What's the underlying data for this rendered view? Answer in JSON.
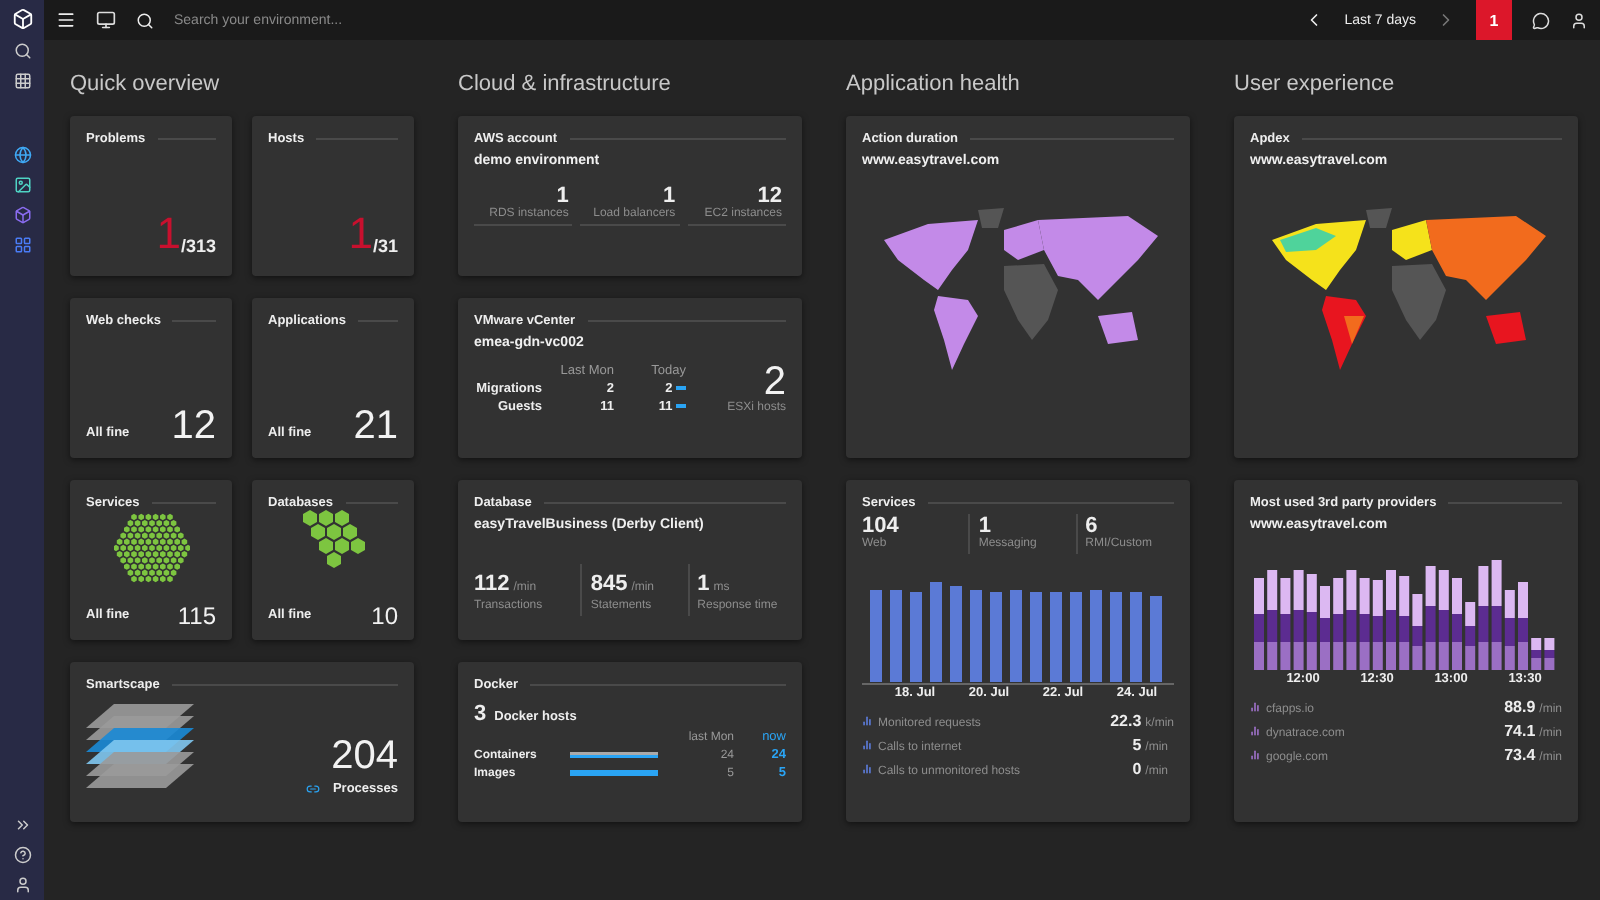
{
  "topbar": {
    "search": {
      "placeholder": "Search your environment..."
    },
    "timeframe": "Last 7 days",
    "problem_badge": "1"
  },
  "columns": [
    {
      "title": "Quick overview",
      "tiles": [
        {
          "kind": "ratio",
          "title": "Problems",
          "value": "1",
          "total": "/313"
        },
        {
          "kind": "ratio",
          "title": "Hosts",
          "value": "1",
          "total": "/31"
        },
        {
          "kind": "status",
          "title": "Web checks",
          "status": "All fine",
          "value": "12"
        },
        {
          "kind": "status",
          "title": "Applications",
          "status": "All fine",
          "value": "21"
        },
        {
          "kind": "hex-many",
          "title": "Services",
          "status": "All fine",
          "value": "115"
        },
        {
          "kind": "hex-few",
          "title": "Databases",
          "status": "All fine",
          "value": "10"
        },
        {
          "kind": "smartscape",
          "title": "Smartscape",
          "value": "204",
          "label": "Processes"
        }
      ]
    },
    {
      "title": "Cloud & infrastructure",
      "tiles": [
        {
          "kind": "aws",
          "title": "AWS account",
          "subtitle": "demo environment",
          "metrics": [
            {
              "value": "1",
              "label": "RDS instances"
            },
            {
              "value": "1",
              "label": "Load balancers"
            },
            {
              "value": "12",
              "label": "EC2 instances"
            }
          ]
        },
        {
          "kind": "vmware",
          "title": "VMware vCenter",
          "subtitle": "emea-gdn-vc002",
          "headers": [
            "Last Mon",
            "Today"
          ],
          "rows": [
            {
              "label": "Migrations",
              "last": "2",
              "today": "2"
            },
            {
              "label": "Guests",
              "last": "11",
              "today": "11"
            }
          ],
          "value": "2",
          "value_label": "ESXi hosts"
        },
        {
          "kind": "database",
          "title": "Database",
          "subtitle": "easyTravelBusiness (Derby Client)",
          "metrics": [
            {
              "value": "112",
              "unit": "/min",
              "label": "Transactions"
            },
            {
              "value": "845",
              "unit": "/min",
              "label": "Statements"
            },
            {
              "value": "1",
              "unit": "ms",
              "label": "Response time"
            }
          ]
        },
        {
          "kind": "docker",
          "title": "Docker",
          "count": "3",
          "count_label": "Docker hosts",
          "headers": [
            "last Mon",
            "now"
          ],
          "rows": [
            {
              "label": "Containers",
              "last": "24",
              "now": "24"
            },
            {
              "label": "Images",
              "last": "5",
              "now": "5"
            }
          ]
        }
      ]
    },
    {
      "title": "Application health",
      "tiles": [
        {
          "kind": "duration-map",
          "title": "Action duration",
          "subtitle": "www.easytravel.com"
        },
        {
          "kind": "services",
          "title": "Services",
          "metrics": [
            {
              "value": "104",
              "label": "Web"
            },
            {
              "value": "1",
              "label": "Messaging"
            },
            {
              "value": "6",
              "label": "RMI/Custom"
            }
          ],
          "x_labels": [
            "18. Jul",
            "20. Jul",
            "22. Jul",
            "24. Jul"
          ],
          "rows": [
            {
              "label": "Monitored requests",
              "value": "22.3",
              "unit": "k/min"
            },
            {
              "label": "Calls to internet",
              "value": "5",
              "unit": "/min"
            },
            {
              "label": "Calls to unmonitored hosts",
              "value": "0",
              "unit": "/min"
            }
          ]
        }
      ]
    },
    {
      "title": "User experience",
      "tiles": [
        {
          "kind": "apdex-map",
          "title": "Apdex",
          "subtitle": "www.easytravel.com"
        },
        {
          "kind": "providers",
          "title": "Most used 3rd party providers",
          "subtitle": "www.easytravel.com",
          "x_labels": [
            "12:00",
            "12:30",
            "13:00",
            "13:30"
          ],
          "rows": [
            {
              "label": "cfapps.io",
              "value": "88.9",
              "unit": "/min"
            },
            {
              "label": "dynatrace.com",
              "value": "74.1",
              "unit": "/min"
            },
            {
              "label": "google.com",
              "value": "73.4",
              "unit": "/min"
            }
          ]
        }
      ]
    }
  ]
}
